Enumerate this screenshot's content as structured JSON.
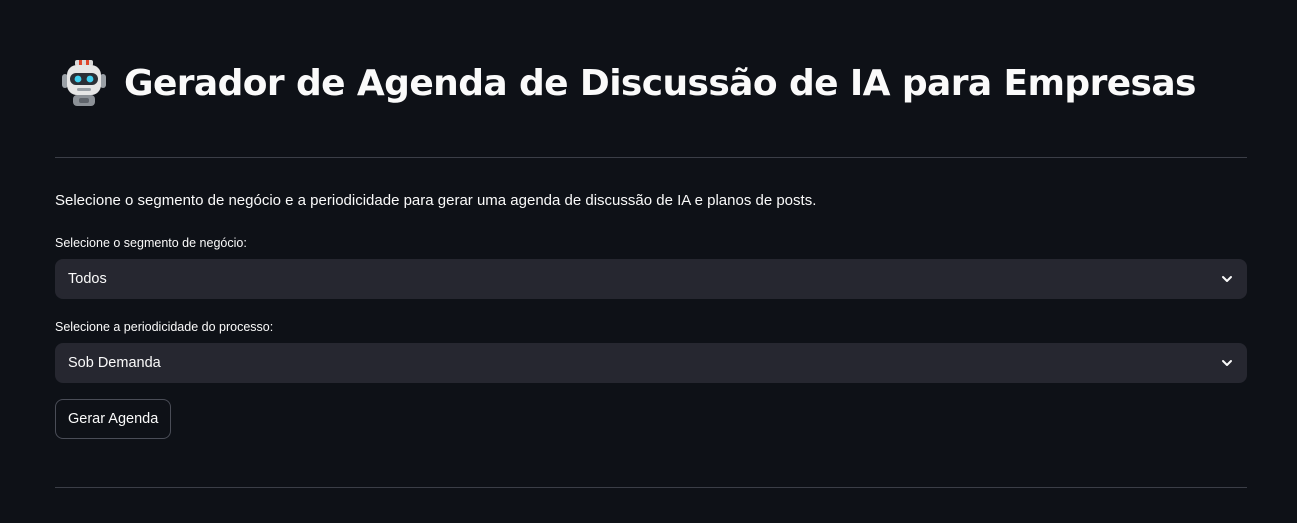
{
  "header": {
    "title": "Gerador de Agenda de Discussão de IA para Empresas",
    "icon": "robot-face-icon"
  },
  "intro_text": "Selecione o segmento de negócio e a periodicidade para gerar uma agenda de discussão de IA e planos de posts.",
  "segment_select": {
    "label": "Selecione o segmento de negócio:",
    "value": "Todos"
  },
  "period_select": {
    "label": "Selecione a periodicidade do processo:",
    "value": "Sob Demanda"
  },
  "actions": {
    "generate_label": "Gerar Agenda"
  },
  "colors": {
    "background": "#0e1117",
    "input_bg": "#262730",
    "text": "#fafafa",
    "divider": "#3b3e47"
  }
}
